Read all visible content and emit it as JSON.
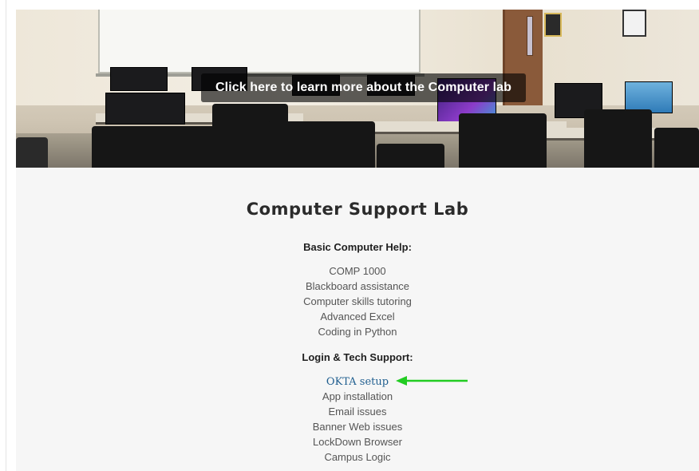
{
  "hero": {
    "caption": "Click here to learn more about the Computer lab",
    "image": "computer-lab-photo"
  },
  "page": {
    "title": "Computer Support Lab"
  },
  "sections": [
    {
      "heading": "Basic Computer Help:",
      "items": [
        "COMP 1000",
        "Blackboard assistance",
        "Computer skills tutoring",
        "Advanced Excel",
        "Coding in Python"
      ]
    },
    {
      "heading": "Login & Tech Support:",
      "link_item": "OKTA setup",
      "items": [
        "App installation",
        "Email issues",
        "Banner Web issues",
        "LockDown Browser",
        "Campus Logic"
      ]
    }
  ],
  "annotation": {
    "arrow_color": "#22cc22",
    "arrow_icon": "arrow-left-icon"
  },
  "colors": {
    "link": "#1f5e8f",
    "panel_bg": "#f6f6f6"
  }
}
